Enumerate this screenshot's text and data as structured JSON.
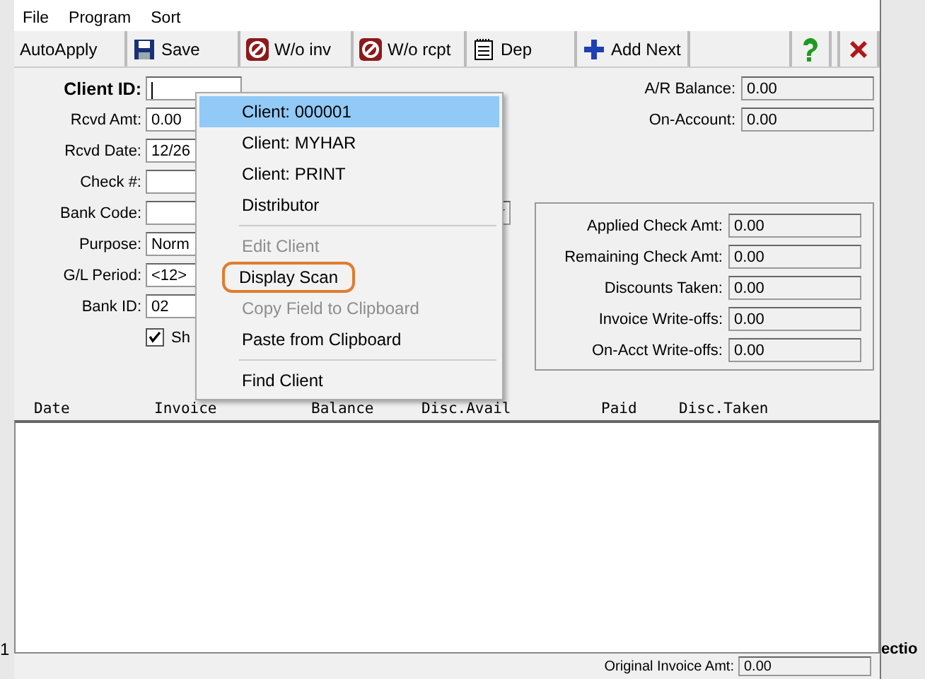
{
  "menu_bar": [
    "File",
    "Program",
    "Sort"
  ],
  "toolbar": [
    "AutoApply",
    "Save",
    "W/o inv",
    "W/o rcpt",
    "Dep",
    "Add Next"
  ],
  "form": {
    "client_id": {
      "label": "Client ID:"
    },
    "fields": [
      {
        "label": "Rcvd Amt:",
        "value": "0.00",
        "kind": "text"
      },
      {
        "label": "Rcvd Date:",
        "value": "12/26",
        "kind": "text"
      },
      {
        "label": "Check #:",
        "kind": "text"
      },
      {
        "label": "Bank Code:",
        "kind": "combo"
      },
      {
        "label": "Purpose:",
        "value": "Norm",
        "kind": "text"
      },
      {
        "label": "G/L Period:",
        "value": "<12>",
        "kind": "text"
      },
      {
        "label": "Bank ID:",
        "value": "02",
        "kind": "text"
      }
    ],
    "checkbox": {
      "label": "Sh",
      "checked": true
    },
    "balances": [
      {
        "label": "A/R Balance:",
        "value": "0.00"
      },
      {
        "label": "On-Account:",
        "value": "0.00"
      }
    ],
    "totals": [
      {
        "label": "Applied Check Amt:",
        "value": "0.00"
      },
      {
        "label": "Remaining Check Amt:",
        "value": "0.00"
      },
      {
        "label": "Discounts Taken:",
        "value": "0.00"
      },
      {
        "label": "Invoice Write-offs:",
        "value": "0.00"
      },
      {
        "label": "On-Acct Write-offs:",
        "value": "0.00"
      }
    ]
  },
  "table": {
    "columns": [
      "Date",
      "Invoice",
      "Balance",
      "Disc.Avail",
      "Paid",
      "Disc.Taken"
    ]
  },
  "footer": {
    "label": "Original Invoice Amt:",
    "value": "0.00"
  },
  "background_window": {
    "left_text": "1",
    "right_text": "ectio"
  },
  "context_menu": [
    {
      "label": "Client: 000001",
      "selected": true,
      "disabled": false,
      "circled": false
    },
    {
      "label": "Client: MYHAR",
      "selected": false,
      "disabled": false,
      "circled": false
    },
    {
      "label": "Client: PRINT",
      "selected": false,
      "disabled": false,
      "circled": false
    },
    {
      "label": "Distributor",
      "selected": false,
      "disabled": false,
      "circled": false,
      "separator_after": true
    },
    {
      "label": "Edit Client",
      "selected": false,
      "disabled": true,
      "circled": false
    },
    {
      "label": "Display Scan",
      "selected": false,
      "disabled": false,
      "circled": true
    },
    {
      "label": "Copy Field to Clipboard",
      "selected": false,
      "disabled": true,
      "circled": false
    },
    {
      "label": "Paste from Clipboard",
      "selected": false,
      "disabled": false,
      "circled": false,
      "separator_after": true
    },
    {
      "label": "Find Client",
      "selected": false,
      "disabled": false,
      "circled": false
    }
  ]
}
